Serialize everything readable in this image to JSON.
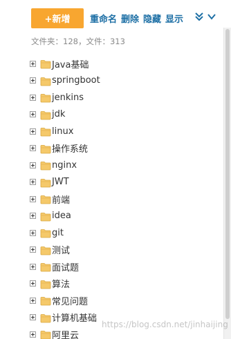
{
  "toolbar": {
    "new_label": "+新增",
    "rename_label": "重命名",
    "delete_label": "删除",
    "hide_label": "隐藏",
    "show_label": "显示",
    "accent_color": "#f8a630",
    "link_color": "#1d6fa5",
    "collapse_icon": "double-chevron-down-icon",
    "expand_icon": "chevron-down-icon"
  },
  "stats": {
    "text": "文件夹：128，文件：313"
  },
  "tree": {
    "expander_icon": "plus-box-icon",
    "folder_icon": "folder-icon",
    "folder_color": "#f5c96a",
    "items": [
      {
        "label": "Java基础"
      },
      {
        "label": "springboot"
      },
      {
        "label": "jenkins"
      },
      {
        "label": "jdk"
      },
      {
        "label": "linux"
      },
      {
        "label": "操作系统"
      },
      {
        "label": "nginx"
      },
      {
        "label": "JWT"
      },
      {
        "label": "前端"
      },
      {
        "label": "idea"
      },
      {
        "label": "git"
      },
      {
        "label": "测试"
      },
      {
        "label": "面试题"
      },
      {
        "label": "算法"
      },
      {
        "label": "常见问题"
      },
      {
        "label": "计算机基础"
      },
      {
        "label": "阿里云"
      }
    ]
  },
  "watermark": {
    "text": "https://blog.csdn.net/jinhaijing"
  }
}
